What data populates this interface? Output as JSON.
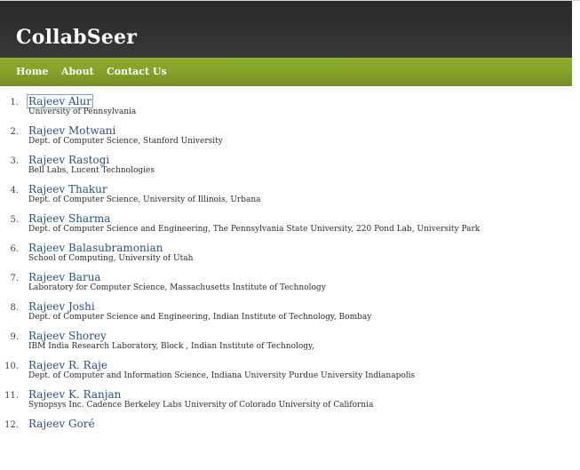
{
  "site": {
    "title": "CollabSeer"
  },
  "nav": {
    "home": "Home",
    "about": "About",
    "contact": "Contact Us"
  },
  "results": [
    {
      "number": "1.",
      "name": "Rajeev Alur",
      "affiliation": "University of Pennsylvania"
    },
    {
      "number": "2.",
      "name": "Rajeev Motwani",
      "affiliation": "Dept. of Computer Science, Stanford University"
    },
    {
      "number": "3.",
      "name": "Rajeev Rastogi",
      "affiliation": "Bell Labs, Lucent Technologies"
    },
    {
      "number": "4.",
      "name": "Rajeev Thakur",
      "affiliation": "Dept. of Computer Science, University of Illinois, Urbana"
    },
    {
      "number": "5.",
      "name": "Rajeev Sharma",
      "affiliation": "Dept. of Computer Science and Engineering, The Pennsylvania State University, 220 Pond Lab, University Park"
    },
    {
      "number": "6.",
      "name": "Rajeev Balasubramonian",
      "affiliation": "School of Computing, University of Utah"
    },
    {
      "number": "7.",
      "name": "Rajeev Barua",
      "affiliation": "Laboratory for Computer Science, Massachusetts Institute of Technology"
    },
    {
      "number": "8.",
      "name": "Rajeev Joshi",
      "affiliation": "Dept. of Computer Science and Engineering, Indian Institute of Technology, Bombay"
    },
    {
      "number": "9.",
      "name": "Rajeev Shorey",
      "affiliation": "IBM India Research Laboratory, Block , Indian Institute of Technology,"
    },
    {
      "number": "10.",
      "name": "Rajeev R. Raje",
      "affiliation": "Dept. of Computer and Information Science, Indiana University Purdue University Indianapolis"
    },
    {
      "number": "11.",
      "name": "Rajeev K. Ranjan",
      "affiliation": "Synopsys Inc. Cadence Berkeley Labs University of Colorado University of California"
    },
    {
      "number": "12.",
      "name": "Rajeev Goré",
      "affiliation": ""
    }
  ]
}
